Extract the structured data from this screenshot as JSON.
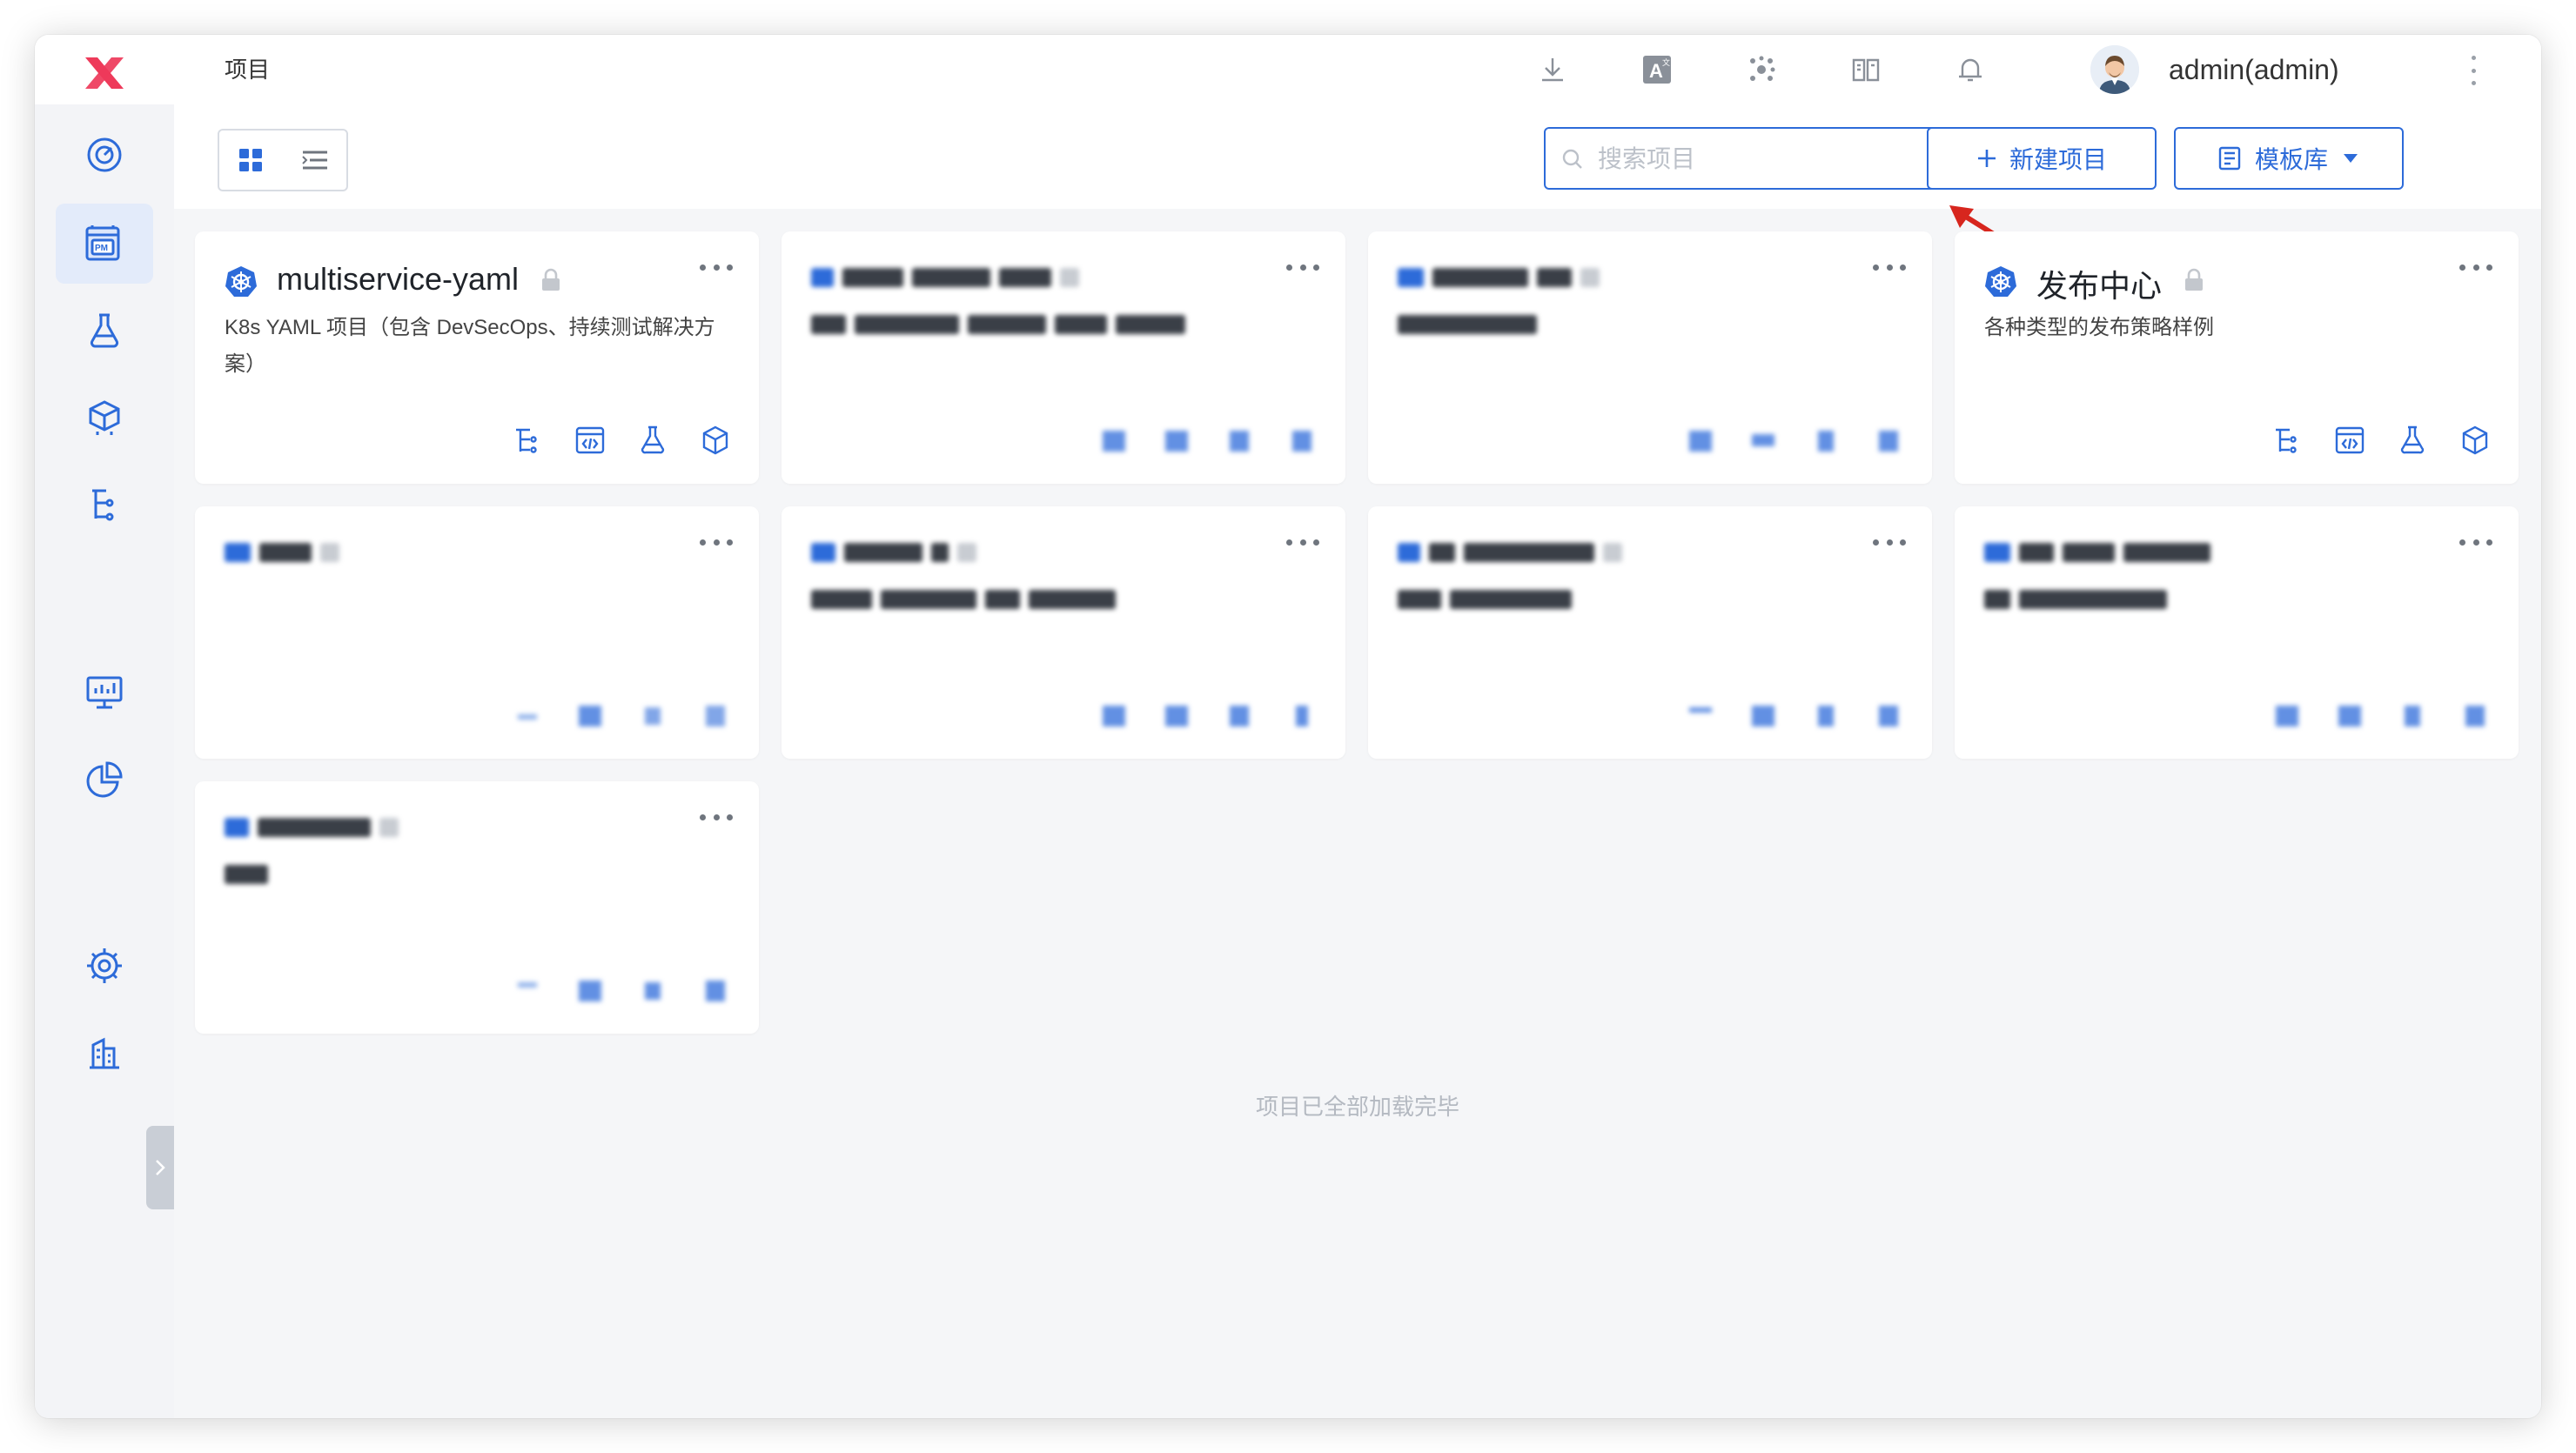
{
  "colors": {
    "accent": "#2d6bd9",
    "logo": "#ee3a5a",
    "annotation_arrow": "#d7261e"
  },
  "header": {
    "breadcrumb": "项目",
    "user_name": "admin(admin)",
    "icons": [
      "download-icon",
      "translate-icon",
      "apps-icon",
      "docs-icon",
      "bell-icon"
    ]
  },
  "sidebar": {
    "items": [
      {
        "name": "dashboard-icon"
      },
      {
        "name": "project-management-icon",
        "badge": "PM",
        "active": true
      },
      {
        "name": "testing-icon"
      },
      {
        "name": "artifacts-icon"
      },
      {
        "name": "workflow-icon"
      },
      {
        "name": "monitor-icon"
      },
      {
        "name": "analytics-icon"
      },
      {
        "name": "settings-icon"
      },
      {
        "name": "resources-icon"
      }
    ]
  },
  "toolbar": {
    "search_placeholder": "搜索项目",
    "new_project_label": "新建项目",
    "template_label": "模板库"
  },
  "projects": [
    {
      "title": "multiservice-yaml",
      "locked": true,
      "description": "K8s YAML 项目（包含 DevSecOps、持续测试解决方案）"
    },
    {
      "title": "",
      "obscured": true
    },
    {
      "title": "",
      "obscured": true
    },
    {
      "title": "发布中心",
      "locked": true,
      "description": "各种类型的发布策略样例"
    },
    {
      "title": "",
      "obscured": true
    },
    {
      "title": "",
      "obscured": true
    },
    {
      "title": "",
      "obscured": true
    },
    {
      "title": "",
      "obscured": true
    },
    {
      "title": "",
      "obscured": true
    }
  ],
  "card_actions": [
    "workflow-icon",
    "environment-icon",
    "testing-icon",
    "service-icon"
  ],
  "footer": {
    "end_text": "项目已全部加载完毕"
  }
}
